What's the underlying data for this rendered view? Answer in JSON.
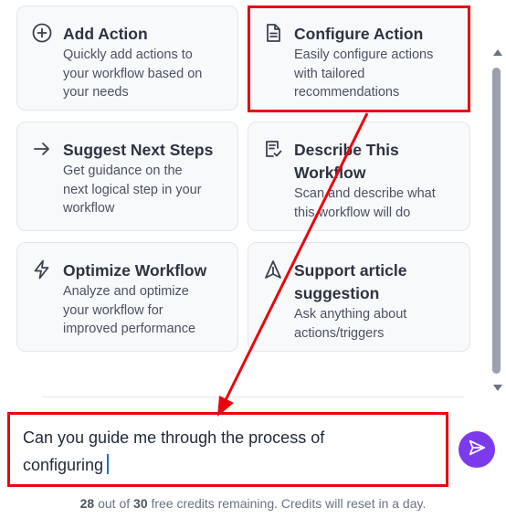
{
  "cards": [
    {
      "title": "Add Action",
      "desc1": "Quickly add actions to",
      "desc2": "your workflow based on",
      "desc3": "your needs",
      "icon": "plus-circle-icon"
    },
    {
      "title": "Configure Action",
      "desc1": "Easily configure actions",
      "desc2": "with tailored",
      "desc3": "recommendations",
      "icon": "document-icon"
    },
    {
      "title": "Suggest Next Steps",
      "desc1": "Get guidance on the",
      "desc2": "next logical step in your",
      "desc3": "workflow",
      "icon": "arrow-right-icon"
    },
    {
      "title1": "Describe This",
      "title2": "Workflow",
      "desc1": "Scan and describe what",
      "desc2": "this workflow will do",
      "icon": "clipboard-check-icon"
    },
    {
      "title": "Optimize Workflow",
      "desc1": "Analyze and optimize",
      "desc2": "your workflow for",
      "desc3": "improved performance",
      "icon": "lightning-icon"
    },
    {
      "title1": "Support article",
      "title2": "suggestion",
      "desc1": "Ask anything about",
      "desc2": "actions/triggers",
      "icon": "navigation-icon"
    }
  ],
  "input": {
    "line1": "Can you guide me through the process of",
    "line2": "configuring"
  },
  "credits": {
    "used": "28",
    "middle": " out of ",
    "total": "30",
    "suffix": " free credits remaining. Credits will reset in a day."
  },
  "colors": {
    "accent": "#7c3aed",
    "annotation": "#e8070f"
  }
}
